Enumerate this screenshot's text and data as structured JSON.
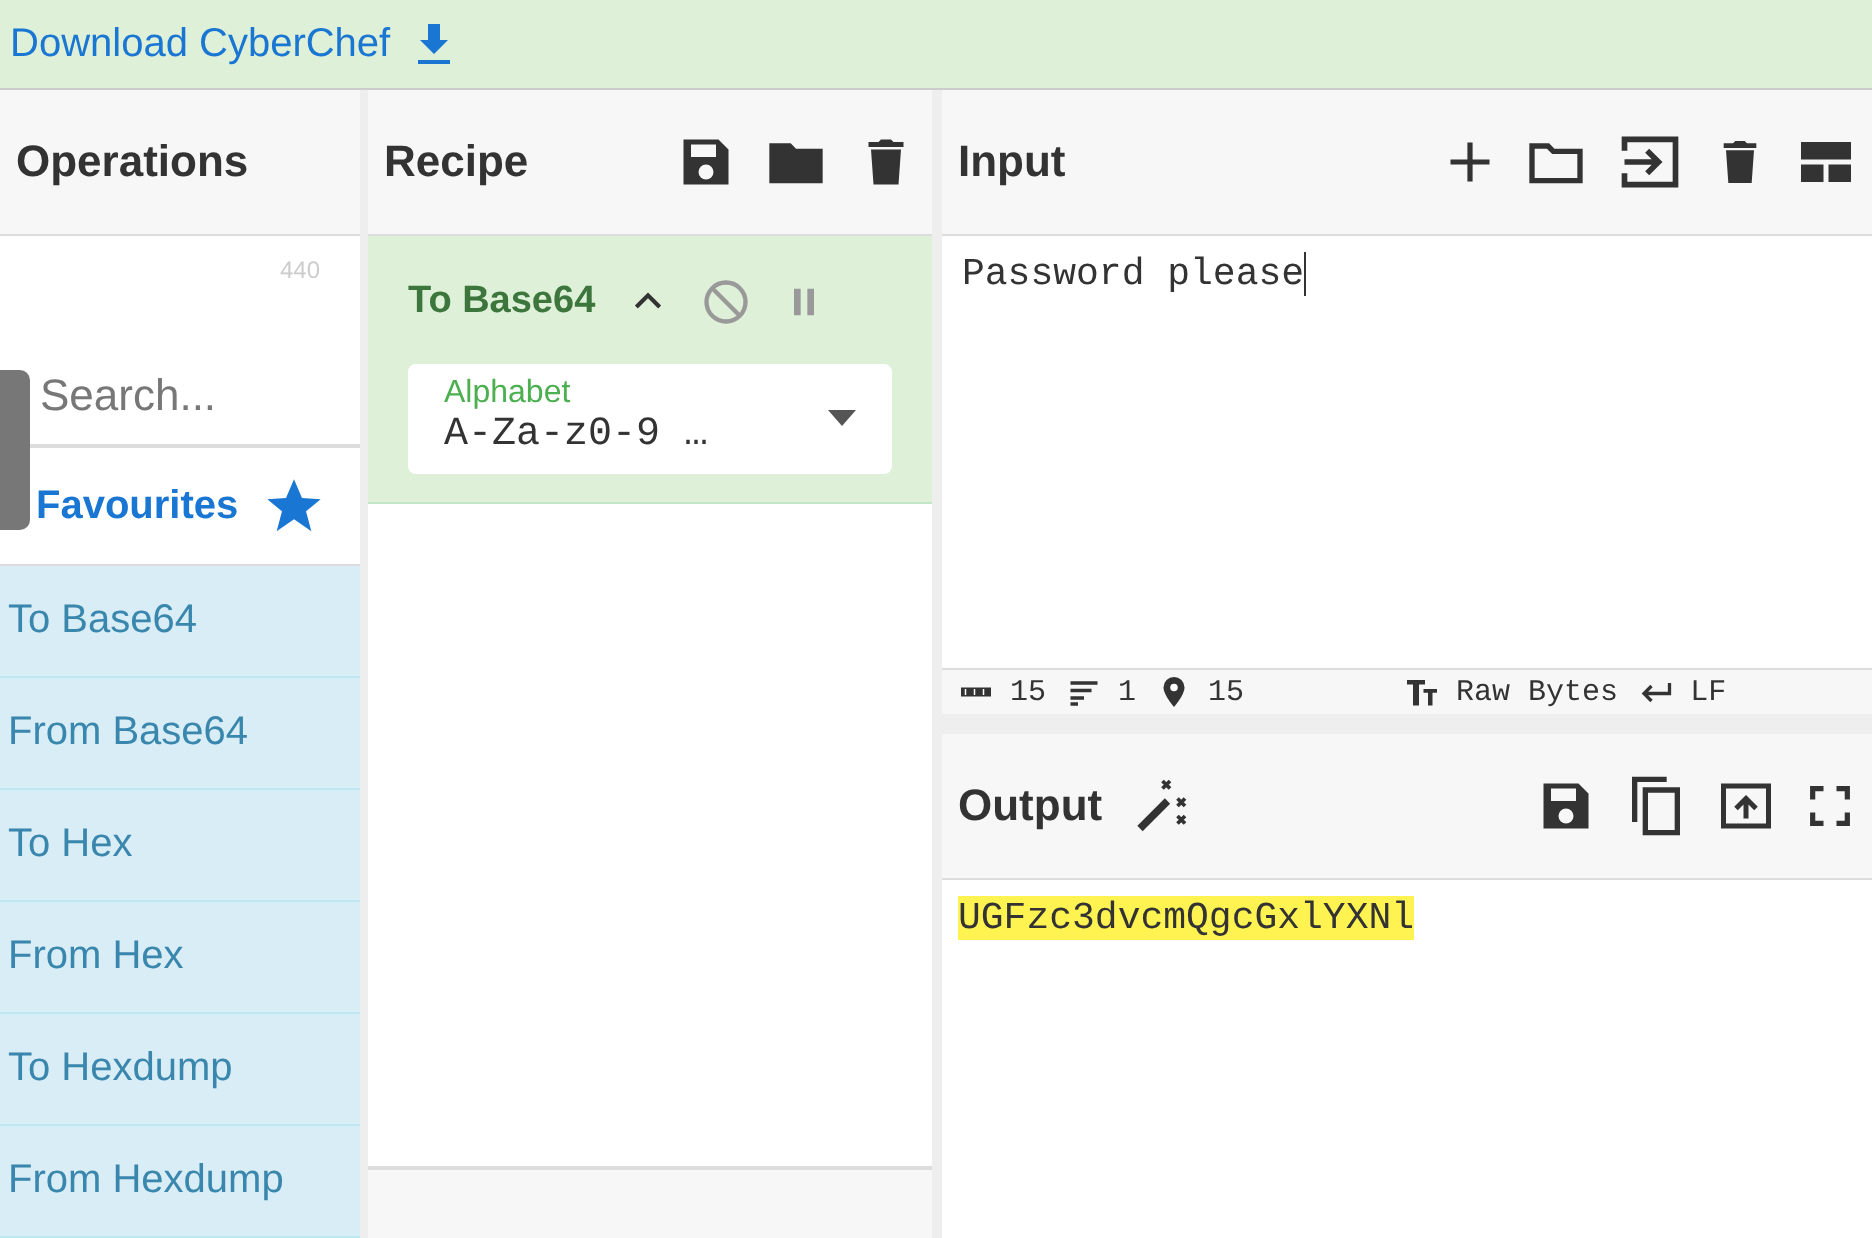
{
  "banner": {
    "link": "Download CyberChef"
  },
  "operations": {
    "title": "Operations",
    "search": {
      "placeholder": "Search...",
      "count": "440"
    },
    "favourites": "Favourites",
    "items": [
      {
        "label": "To Base64"
      },
      {
        "label": "From Base64"
      },
      {
        "label": "To Hex"
      },
      {
        "label": "From Hex"
      },
      {
        "label": "To Hexdump"
      },
      {
        "label": "From Hexdump"
      }
    ]
  },
  "recipe": {
    "title": "Recipe",
    "ingredients": [
      {
        "name": "To Base64",
        "arg": {
          "label": "Alphabet",
          "value": "A-Za-z0-9 …"
        }
      }
    ]
  },
  "input": {
    "title": "Input",
    "text": "Password please",
    "status": [
      {
        "kind": "length",
        "value": "15"
      },
      {
        "kind": "lines",
        "value": "1"
      },
      {
        "kind": "position",
        "value": "15"
      },
      {
        "kind": "encoding",
        "value": "Raw Bytes"
      },
      {
        "kind": "eol",
        "value": "LF"
      }
    ]
  },
  "output": {
    "title": "Output",
    "text": "UGFzc3dvcmQgcGxlYXNl",
    "highlighted": true
  }
}
